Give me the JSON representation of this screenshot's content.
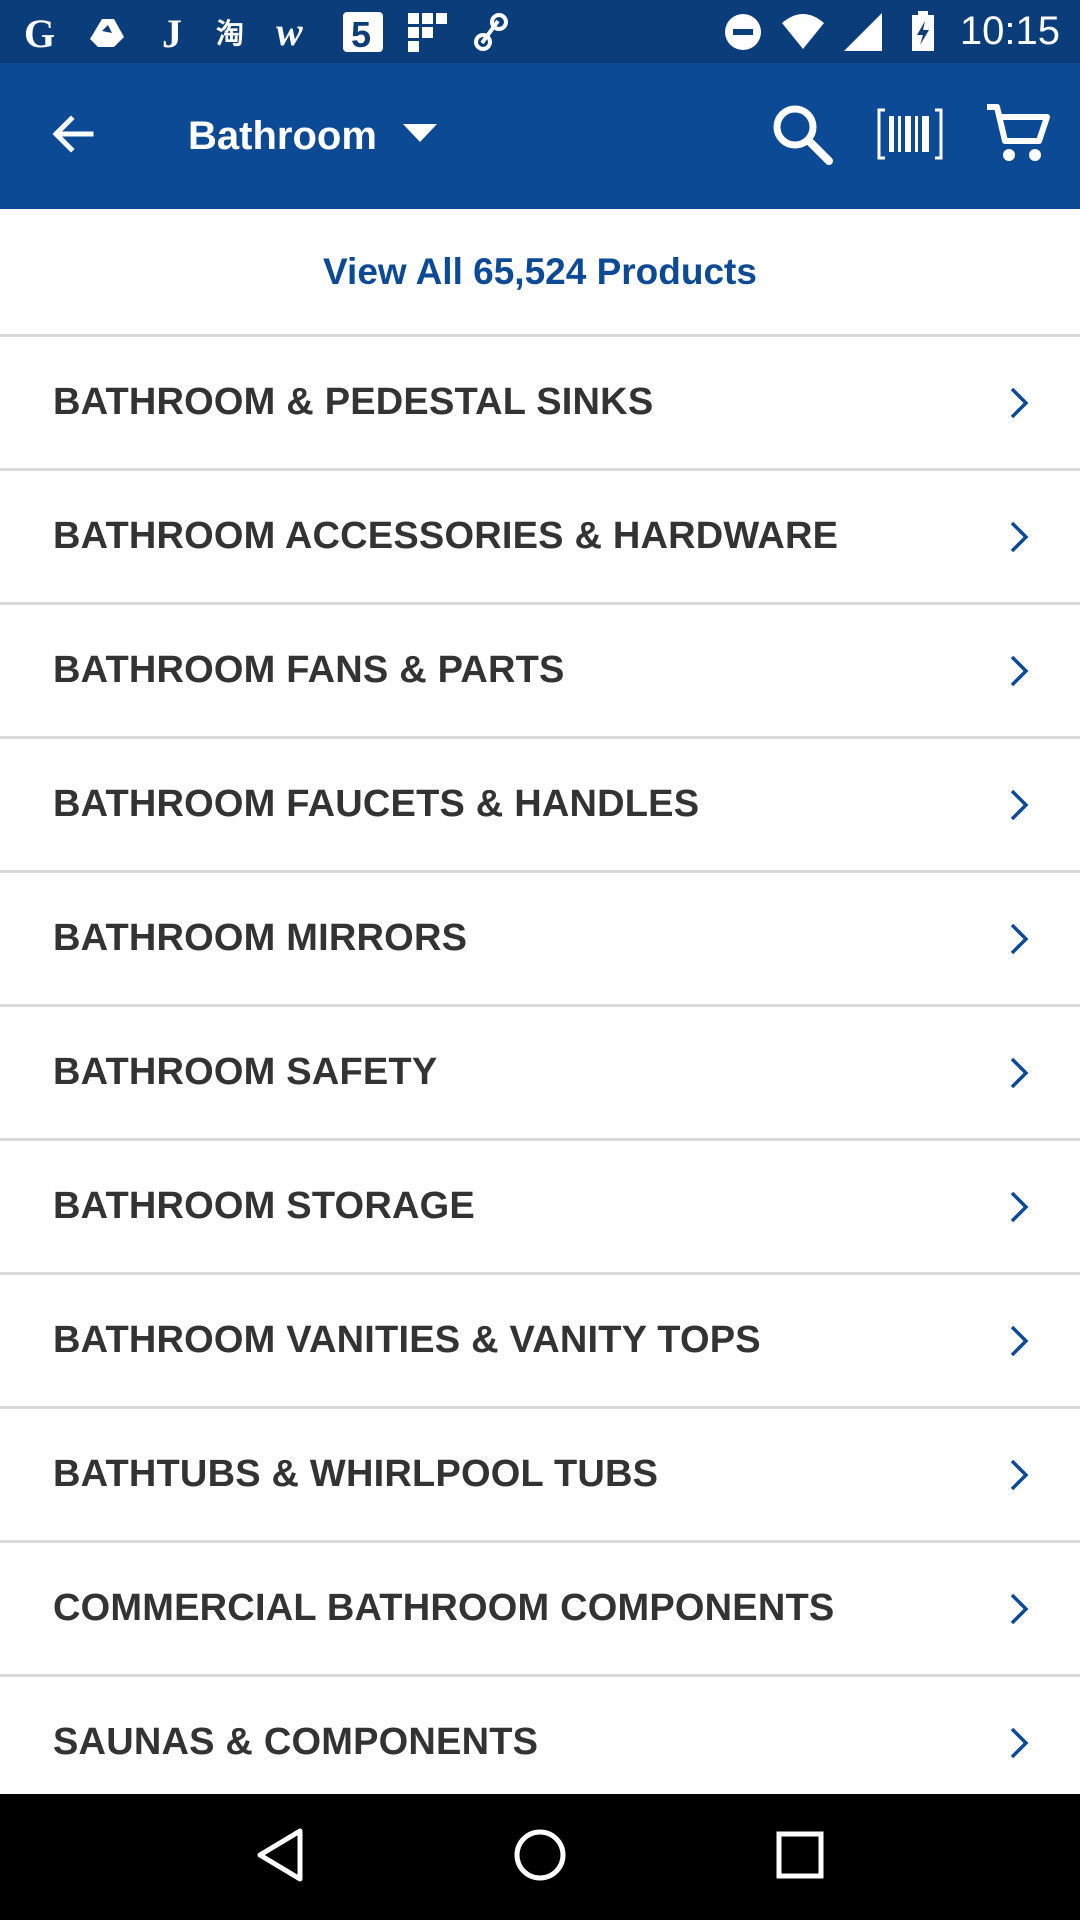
{
  "status_bar": {
    "time": "10:15",
    "left_icons": [
      "google-icon",
      "drive-icon",
      "j-app-icon",
      "taobao-icon",
      "w-app-icon",
      "five-app-icon",
      "grid-app-icon",
      "link-app-icon"
    ],
    "right_icons": [
      "do-not-disturb-icon",
      "wifi-icon",
      "signal-icon",
      "battery-charging-icon"
    ]
  },
  "app_bar": {
    "title": "Bathroom",
    "icons": [
      "back-arrow-icon",
      "dropdown-caret-icon",
      "search-icon",
      "barcode-icon",
      "cart-icon"
    ],
    "background": "#0d4a96"
  },
  "view_all": {
    "label": "View All 65,524 Products",
    "color": "#0d4a96"
  },
  "categories": [
    {
      "label": "BATHROOM & PEDESTAL SINKS"
    },
    {
      "label": "BATHROOM ACCESSORIES & HARDWARE"
    },
    {
      "label": "BATHROOM FANS & PARTS"
    },
    {
      "label": "BATHROOM FAUCETS & HANDLES"
    },
    {
      "label": "BATHROOM MIRRORS"
    },
    {
      "label": "BATHROOM SAFETY"
    },
    {
      "label": "BATHROOM STORAGE"
    },
    {
      "label": "BATHROOM VANITIES & VANITY TOPS"
    },
    {
      "label": "BATHTUBS & WHIRLPOOL TUBS"
    },
    {
      "label": "COMMERCIAL BATHROOM COMPONENTS"
    },
    {
      "label": "SAUNAS & COMPONENTS"
    }
  ],
  "nav_bar": {
    "icons": [
      "back-triangle-icon",
      "home-circle-icon",
      "recents-square-icon"
    ]
  }
}
